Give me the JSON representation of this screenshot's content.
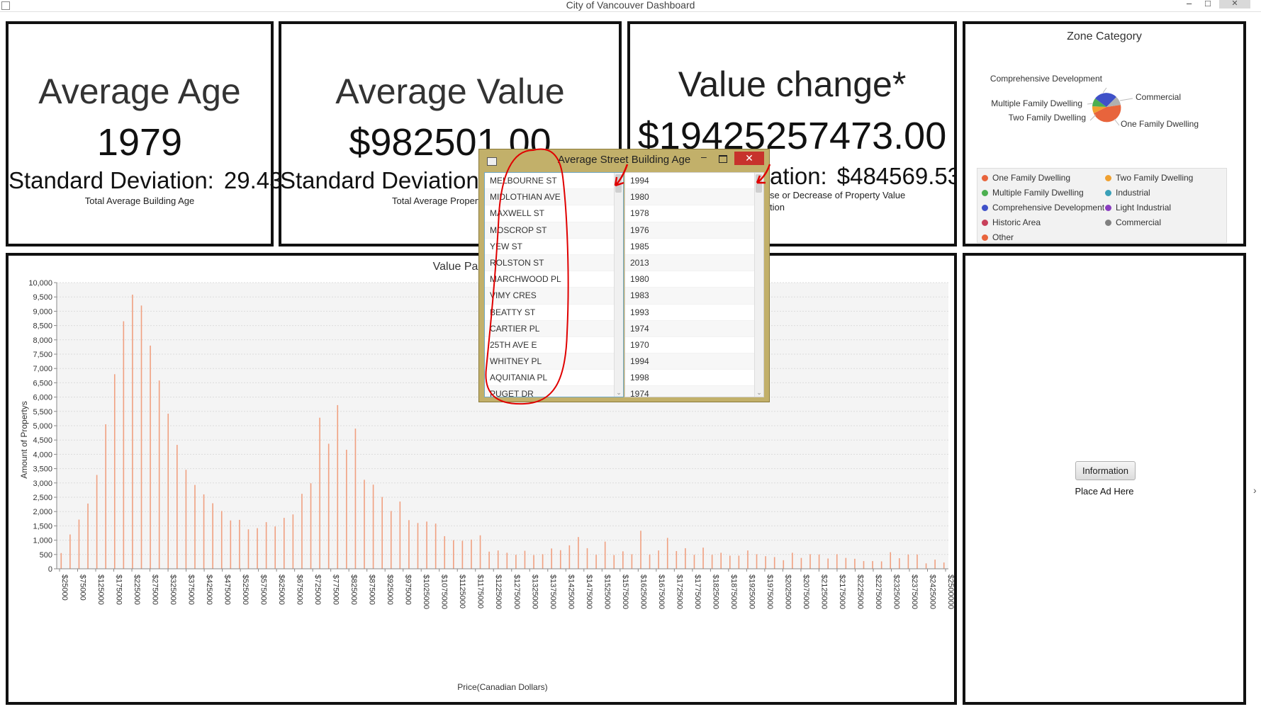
{
  "window": {
    "title": "City of Vancouver Dashboard",
    "minimize": "–",
    "maximize": "□",
    "close": "✕"
  },
  "age_panel": {
    "title": "Average Age",
    "value": "1979",
    "sd_label": "Standard Deviation:",
    "sd_value": "29.43",
    "subtitle": "Total Average Building Age"
  },
  "value_panel": {
    "title": "Average Value",
    "value": "$982501.00",
    "sd_label": "Standard Deviation:",
    "subtitle": "Total Average Propert"
  },
  "change_panel": {
    "title": "Value change*",
    "value": "$19425257473.00",
    "sd_label": "ation:",
    "sd_value": "$484569.53",
    "subtitle_line1": "se or Decrease of Property Value",
    "subtitle_line2": "tion"
  },
  "zone_panel": {
    "title": "Zone Category",
    "pie_labels": {
      "comprehensive": "Comprehensive Development",
      "commercial": "Commercial",
      "multiple": "Multiple Family Dwelling",
      "two": "Two Family Dwelling",
      "one": "One Family Dwelling"
    },
    "legend": [
      {
        "label": "One Family Dwelling",
        "color": "#e8643c"
      },
      {
        "label": "Two Family Dwelling",
        "color": "#f0a030"
      },
      {
        "label": "Multiple Family Dwelling",
        "color": "#4caf50"
      },
      {
        "label": "Industrial",
        "color": "#3aa0b8"
      },
      {
        "label": "Comprehensive Development",
        "color": "#3f51c8"
      },
      {
        "label": "Light Industrial",
        "color": "#8a3ec0"
      },
      {
        "label": "Historic Area",
        "color": "#c8405a"
      },
      {
        "label": "Commercial",
        "color": "#808080"
      },
      {
        "label": "Other",
        "color": "#e8643c"
      }
    ]
  },
  "ad_panel": {
    "button": "Information",
    "label": "Place Ad Here"
  },
  "dialog": {
    "title": "Average Street Building Age",
    "close": "✕",
    "minimize": "–",
    "streets": [
      "MELBOURNE ST",
      "MIDLOTHIAN AVE",
      "MAXWELL ST",
      "MOSCROP ST",
      "YEW ST",
      "ROLSTON ST",
      "MARCHWOOD PL",
      "VIMY CRES",
      "BEATTY ST",
      "CARTIER PL",
      "25TH AVE E",
      "WHITNEY PL",
      "AQUITANIA PL",
      "PUGET DR"
    ],
    "ages": [
      "1994",
      "1980",
      "1978",
      "1976",
      "1985",
      "2013",
      "1980",
      "1983",
      "1993",
      "1974",
      "1970",
      "1994",
      "1998",
      "1974"
    ]
  },
  "colors": {
    "bar": "#f0a080",
    "annotation": "#e00000",
    "dialog_frame": "#c2b06a"
  },
  "chart_data": {
    "type": "bar",
    "title": "Value Partitions(Up",
    "xlabel": "Price(Canadian Dollars)",
    "ylabel": "Amount of Propertys",
    "ylim": [
      0,
      10000
    ],
    "y_ticks": [
      "0",
      "500",
      "1,000",
      "1,500",
      "2,000",
      "2,500",
      "3,000",
      "3,500",
      "4,000",
      "4,500",
      "5,000",
      "5,500",
      "6,000",
      "6,500",
      "7,000",
      "7,500",
      "8,000",
      "8,500",
      "9,000",
      "9,500",
      "10,000"
    ],
    "x_tick_labels": [
      "$25000",
      "$75000",
      "$125000",
      "$175000",
      "$225000",
      "$275000",
      "$325000",
      "$375000",
      "$425000",
      "$475000",
      "$525000",
      "$575000",
      "$625000",
      "$675000",
      "$725000",
      "$775000",
      "$825000",
      "$875000",
      "$925000",
      "$975000",
      "$1025000",
      "$1075000",
      "$1125000",
      "$1175000",
      "$1225000",
      "$1275000",
      "$1325000",
      "$1375000",
      "$1425000",
      "$1475000",
      "$1525000",
      "$1575000",
      "$1625000",
      "$1675000",
      "$1725000",
      "$1775000",
      "$1825000",
      "$1875000",
      "$1925000",
      "$1975000",
      "$2025000",
      "$2075000",
      "$2125000",
      "$2175000",
      "$2225000",
      "$2275000",
      "$2325000",
      "$2375000",
      "$2425000",
      "$2500000"
    ],
    "values": [
      550,
      1200,
      1720,
      2280,
      3280,
      5050,
      6800,
      8650,
      9580,
      9200,
      7800,
      6580,
      5420,
      4330,
      3460,
      2930,
      2600,
      2290,
      2020,
      1690,
      1710,
      1380,
      1420,
      1630,
      1480,
      1780,
      1900,
      2620,
      2990,
      5280,
      4370,
      5720,
      4160,
      4900,
      3110,
      2940,
      2510,
      2020,
      2350,
      1700,
      1600,
      1650,
      1580,
      1140,
      1000,
      980,
      1020,
      1170,
      600,
      640,
      560,
      490,
      630,
      480,
      510,
      710,
      650,
      820,
      1110,
      720,
      490,
      950,
      480,
      610,
      510,
      1330,
      500,
      640,
      1080,
      620,
      720,
      490,
      740,
      490,
      560,
      460,
      460,
      640,
      510,
      440,
      410,
      300,
      560,
      380,
      510,
      500,
      360,
      510,
      380,
      350,
      270,
      270,
      260,
      580,
      370,
      500,
      500,
      190,
      320,
      220
    ]
  }
}
